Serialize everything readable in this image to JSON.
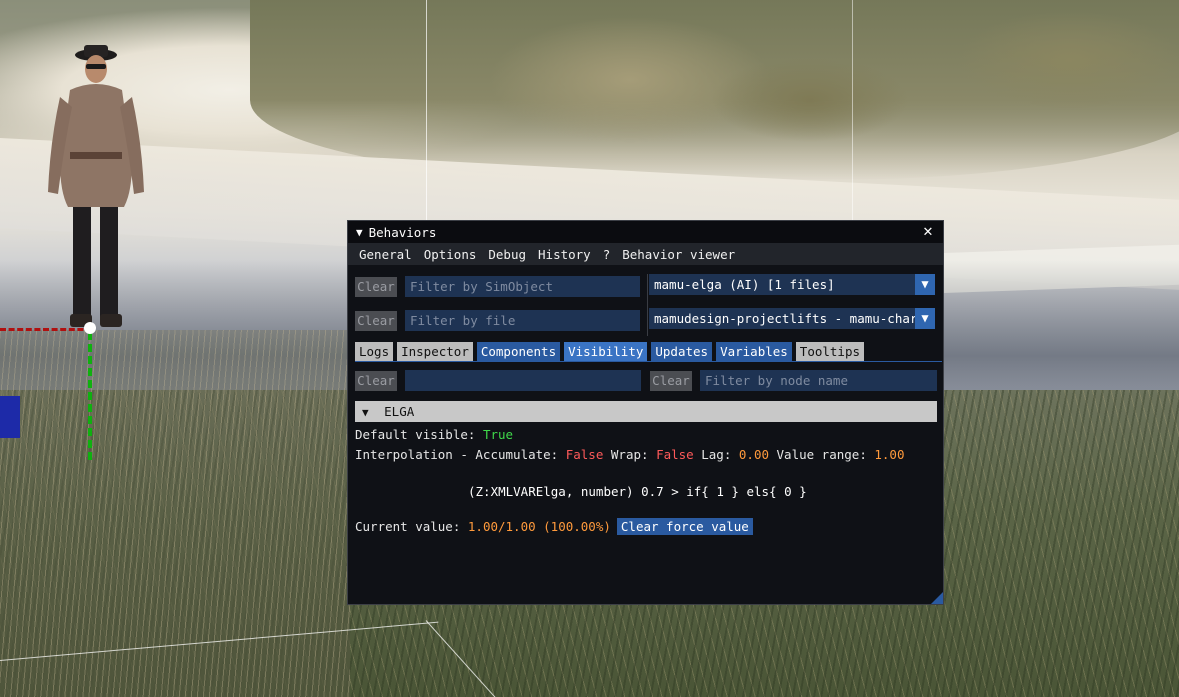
{
  "window": {
    "title": "Behaviors",
    "close_label": "✕"
  },
  "menu": [
    "General",
    "Options",
    "Debug",
    "History",
    "?",
    "Behavior viewer"
  ],
  "filters": {
    "clear_label": "Clear",
    "simobject_placeholder": "Filter by SimObject",
    "file_placeholder": "Filter by file",
    "node_placeholder": "Filter by node name",
    "empty_filter_value": ""
  },
  "combos": {
    "simobject_selected": "mamu-elga (AI) [1 files]",
    "file_selected": "mamudesign-projectlifts - mamu-charac"
  },
  "tabs": [
    {
      "label": "Logs",
      "active": false
    },
    {
      "label": "Inspector",
      "active": false
    },
    {
      "label": "Components",
      "active": true
    },
    {
      "label": "Visibility",
      "active": true
    },
    {
      "label": "Updates",
      "active": true
    },
    {
      "label": "Variables",
      "active": true
    },
    {
      "label": "Tooltips",
      "active": false
    }
  ],
  "node": {
    "name": "ELGA",
    "default_visible_label": "Default visible:",
    "default_visible_value": "True",
    "interp_label": "Interpolation - Accumulate:",
    "accumulate_value": "False",
    "wrap_label": "Wrap:",
    "wrap_value": "False",
    "lag_label": "Lag:",
    "lag_value": "0.00",
    "range_label": "Value range:",
    "range_value": "1.00",
    "expression": "(Z:XMLVARElga, number) 0.7 > if{ 1 } els{ 0 }",
    "current_label": "Current value:",
    "current_value": "1.00/1.00 (100.00%)",
    "force_button": "Clear force value"
  },
  "colors": {
    "true": "#3fd84a",
    "false": "#ff5a5a",
    "number": "#ff9a3c",
    "accent": "#2a5aa0"
  }
}
